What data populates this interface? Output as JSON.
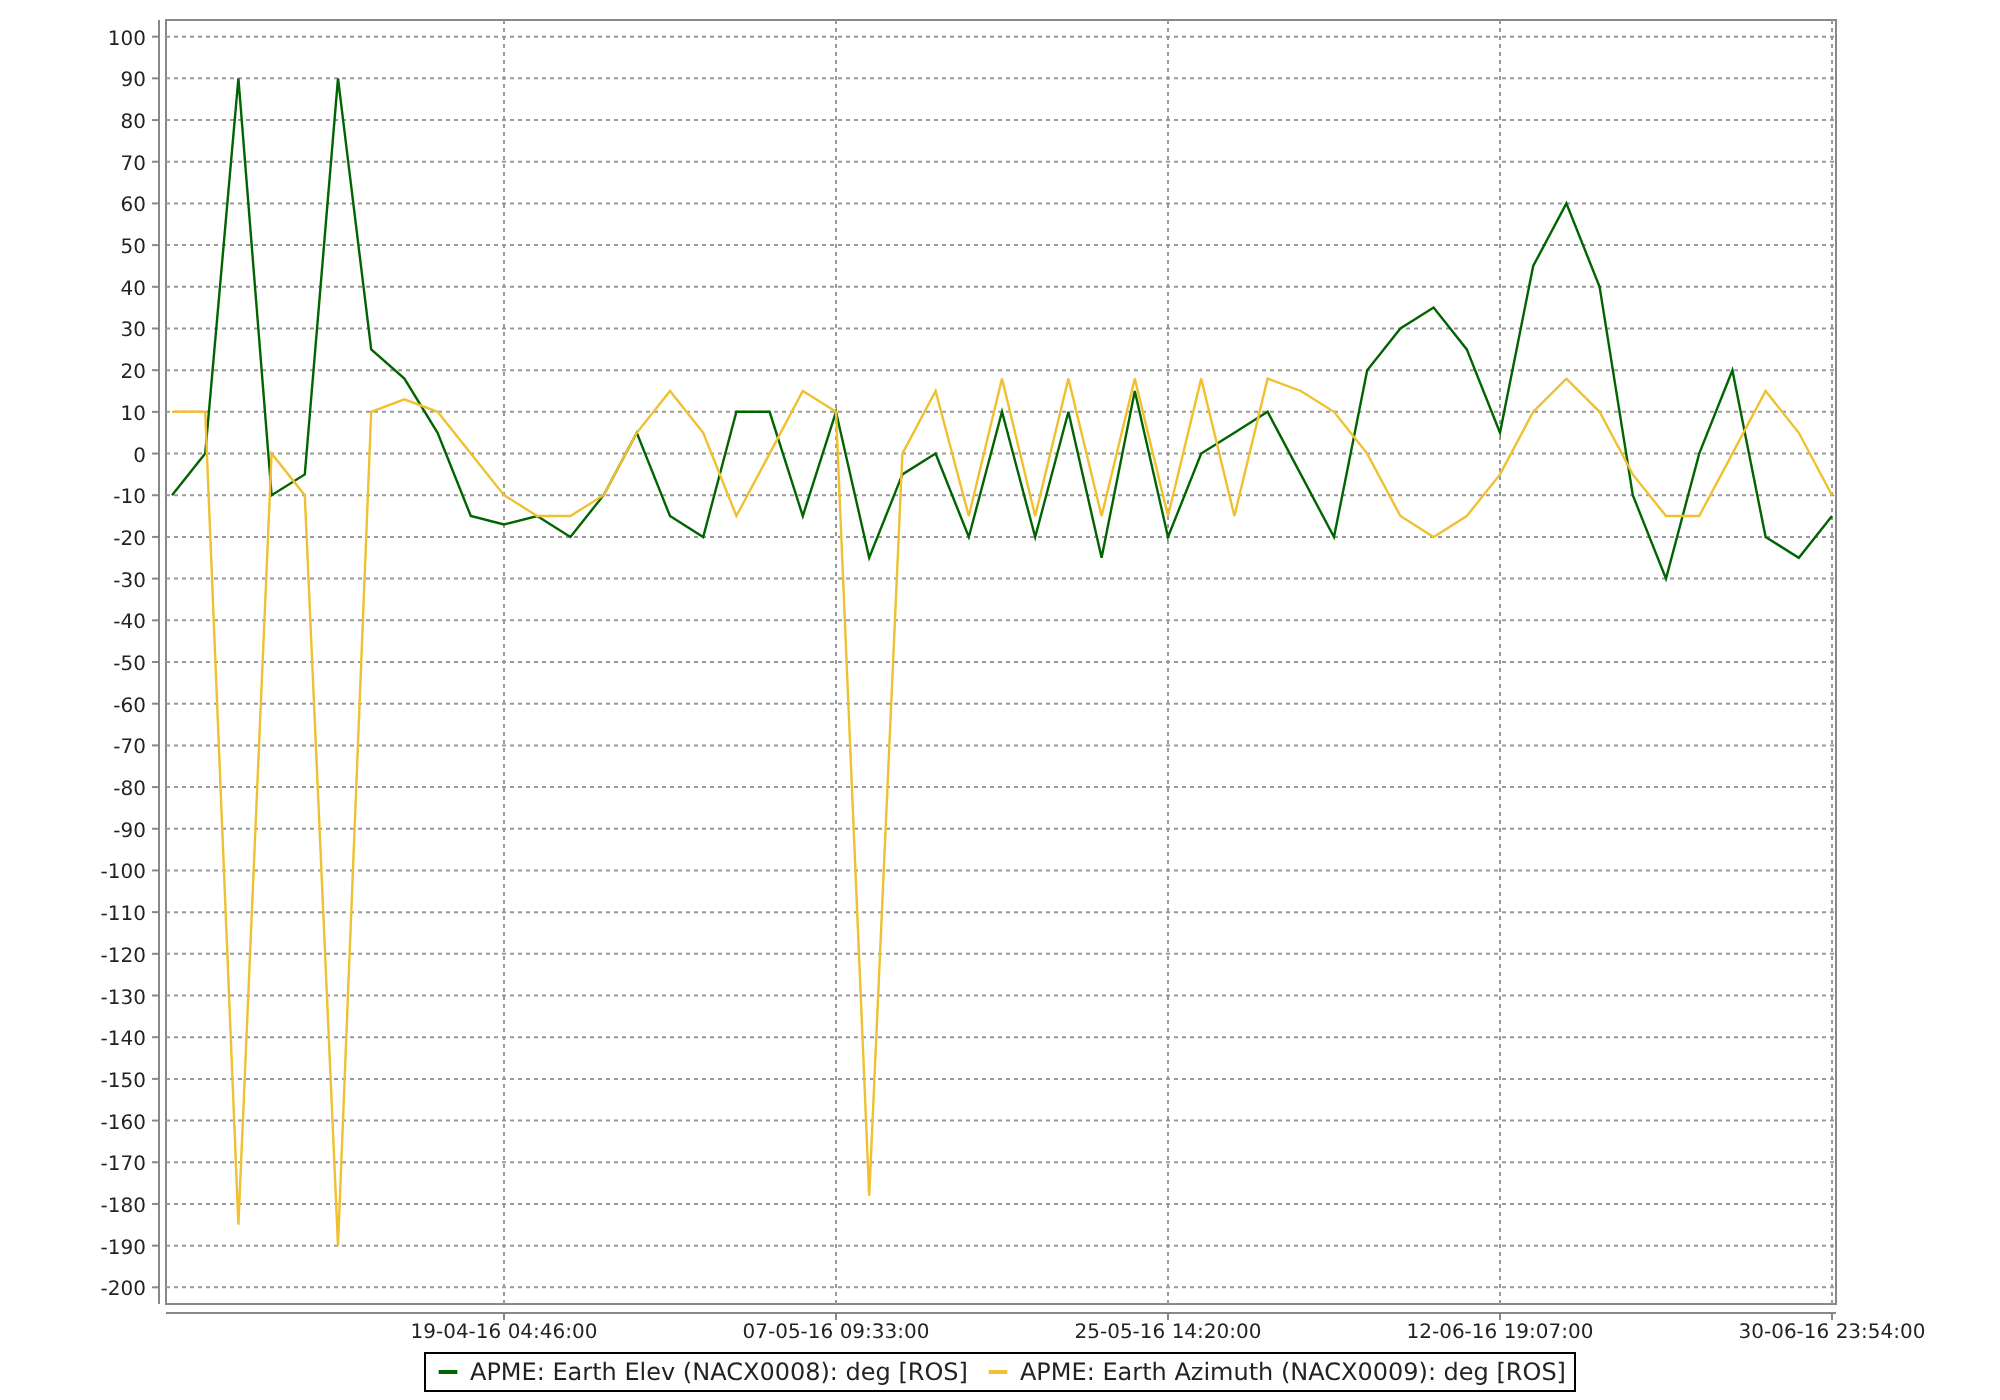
{
  "chart": {
    "chart_data": {
      "type": "line",
      "grid": true,
      "ylim": [
        -204,
        104
      ],
      "yticks": [
        100,
        90,
        80,
        70,
        60,
        50,
        40,
        30,
        20,
        10,
        0,
        -10,
        -20,
        -30,
        -40,
        -50,
        -60,
        -70,
        -80,
        -90,
        -100,
        -110,
        -120,
        -130,
        -140,
        -150,
        -160,
        -170,
        -180,
        -190,
        -200
      ],
      "categories": [
        null,
        null,
        null,
        null,
        null,
        null,
        null,
        null,
        null,
        null,
        "19-04-16 04:46:00",
        null,
        null,
        null,
        null,
        null,
        null,
        null,
        null,
        null,
        "07-05-16 09:33:00",
        null,
        null,
        null,
        null,
        null,
        null,
        null,
        null,
        null,
        "25-05-16 14:20:00",
        null,
        null,
        null,
        null,
        null,
        null,
        null,
        null,
        null,
        "12-06-16 19:07:00",
        null,
        null,
        null,
        null,
        null,
        null,
        null,
        null,
        null,
        "30-06-16 23:54:00"
      ],
      "series": [
        {
          "name": "APME: Earth Elev (NACX0008): deg [ROS]",
          "color": "#006400",
          "values": [
            -10,
            0,
            90,
            -10,
            -5,
            90,
            25,
            18,
            5,
            -15,
            -17,
            -15,
            -20,
            -10,
            5,
            -15,
            -20,
            10,
            10,
            -15,
            10,
            -25,
            -5,
            0,
            -20,
            10,
            -20,
            10,
            -25,
            15,
            -20,
            0,
            5,
            10,
            -5,
            -20,
            20,
            30,
            35,
            25,
            5,
            45,
            60,
            40,
            -10,
            -30,
            0,
            20,
            -20,
            -25,
            -15
          ]
        },
        {
          "name": "APME: Earth Azimuth (NACX0009): deg [ROS]",
          "color": "#f0c030",
          "values": [
            10,
            10,
            -185,
            0,
            -10,
            -190,
            10,
            13,
            10,
            0,
            -10,
            -15,
            -15,
            -10,
            5,
            15,
            5,
            -15,
            0,
            15,
            10,
            -178,
            0,
            15,
            -15,
            18,
            -15,
            18,
            -15,
            18,
            -15,
            18,
            -15,
            18,
            15,
            10,
            0,
            -15,
            -20,
            -15,
            -5,
            10,
            18,
            10,
            -5,
            -15,
            -15,
            0,
            15,
            5,
            -10
          ]
        }
      ]
    }
  }
}
